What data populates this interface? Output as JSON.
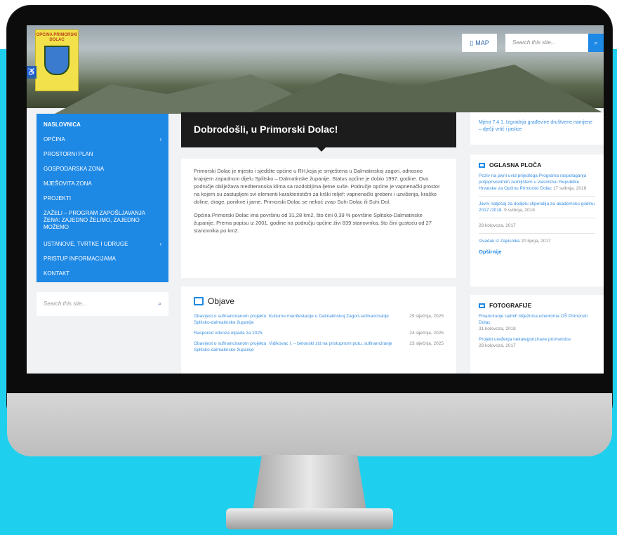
{
  "header": {
    "logo_text": "OPĆINA PRIMORSKI DOLAC",
    "map_label": "MAP",
    "search_placeholder": "Search this site..."
  },
  "nav": {
    "items": [
      {
        "label": "NASLOVNICA",
        "has_children": false
      },
      {
        "label": "OPĆINA",
        "has_children": true
      },
      {
        "label": "PROSTORNI PLAN",
        "has_children": false
      },
      {
        "label": "GOSPODARSKA ZONA",
        "has_children": false
      },
      {
        "label": "MJEŠOVITA ZONA",
        "has_children": false
      },
      {
        "label": "PROJEKTI",
        "has_children": false
      },
      {
        "label": "ZAŽELI – PROGRAM ZAPOŠLJAVANJA ŽENA: ZAJEDNO ŽELIMO, ZAJEDNO MOŽEMO",
        "has_children": false
      },
      {
        "label": "USTANOVE, TVRTKE I UDRUGE",
        "has_children": true
      },
      {
        "label": "PRISTUP INFORMACIJAMA",
        "has_children": false
      },
      {
        "label": "KONTAKT",
        "has_children": false
      }
    ]
  },
  "sidebar_search": {
    "placeholder": "Search this site..."
  },
  "main": {
    "welcome_title": "Dobrodošli, u Primorski Dolac!",
    "intro_p1": "Primorski Dolac je mjesto i sjedište općine u RH,koja je smještena u Dalmatinskoj zagori, odnosno krajnjem zapadnom dijelu Splitsko – Dalmatinske županije. Status općine je dobio 1997. godine. Ovo područje obilježava mediteranska klima sa razdobljima ljetne suše. Područje općine je vapnenački prostor na kojem su zastupljeni svi elementi karakteristični za krški reljef: vapnenački grebeni i uzvišenja, kraške doline, drage, ponikve i jame. Primorski Dolac se nekoć zvao Suhi Dolac ili Suhi Dol.",
    "intro_p2": "Općina Primorski Dolac ima površinu od 31,28 km2, što čini 0,39 % površine Splitsko-Dalmatinske županije. Prema popisu iz 2001. godine na području općine živi 839 stanovnika, što čini gustoću od 27 stanovnika po km2.",
    "objave_title": "Objave",
    "objave": [
      {
        "title": "Obavijest o sufinanciranom projektu: Kulturne manifestacije u Dalmatinskoj Zagori-sufinanciranje Splitsko-dalmatinske županije",
        "date": "29 siječnja, 2025"
      },
      {
        "title": "Raspored odvoza otpada za 2025.",
        "date": "24 siječnja, 2025"
      },
      {
        "title": "Obavijest o sufinanciranom projektu: Vidikovac I. – betonski zid na pristupnom putu, sufinanciranje Splitsko-dalmatinske županije",
        "date": "23 siječnja, 2025"
      }
    ]
  },
  "right": {
    "box1_link": "Mjera 7.4.1. Izgradnja građevine društvene namjene – dječji vrtić i jaslice",
    "oglasna_title": "OGLASNA PLOČA",
    "oglasna": [
      {
        "title": "Poziv na javni uvid prijedloga Programa raspolaganja poljoprivrednim zemljištem u vlasništvu Republike Hrvatske za Općinu Primorski Dolac",
        "date": "17 svibnja, 2018"
      },
      {
        "title": "Javni natječaj za dodjelu stipendija za akademsku godinu 2017./2018.",
        "date": "9 svibnja, 2018"
      },
      {
        "title": "",
        "date": "28 kolovoza, 2017"
      },
      {
        "title": "Izvadak iz Zapisnika",
        "date": "20 lipnja, 2017"
      }
    ],
    "oglasna_more": "Opširnije",
    "foto_title": "FOTOGRAFIJE",
    "foto": [
      {
        "title": "Financiranje radnih bilježnica učenicima OŠ Primorski Dolac",
        "date": "31 kolovoza, 2018"
      },
      {
        "title": "Projekt uređenja nekategoriziranе prometnice",
        "date": "28 kolovoza, 2017"
      }
    ]
  },
  "colors": {
    "accent": "#1e88e5",
    "background_cyan": "#1fd0ee",
    "title_bar": "#1c1c1c"
  }
}
